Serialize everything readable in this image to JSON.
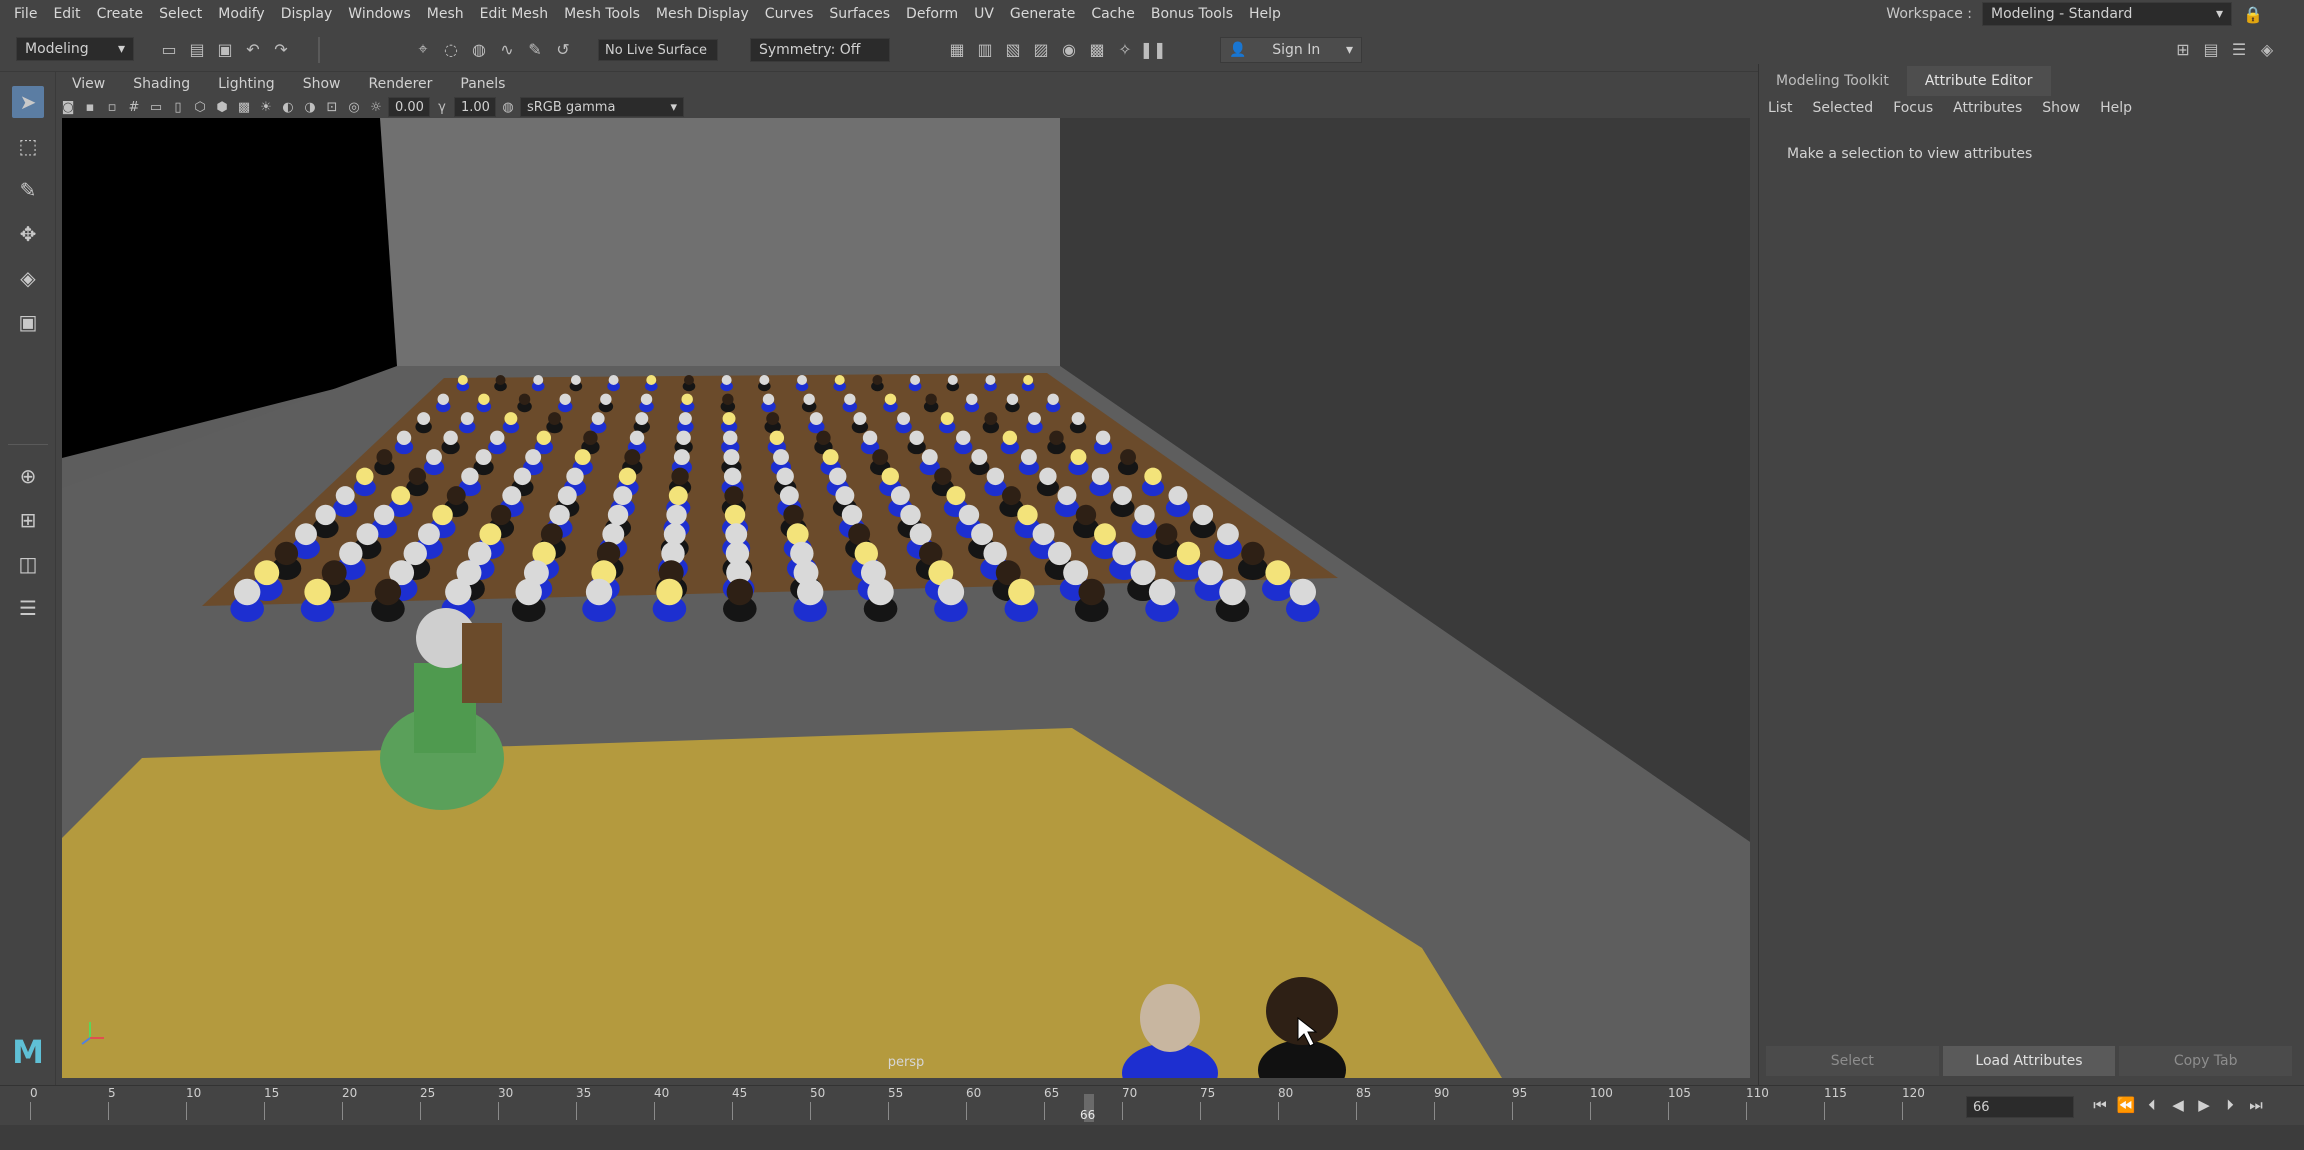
{
  "menubar": {
    "items": [
      "File",
      "Edit",
      "Create",
      "Select",
      "Modify",
      "Display",
      "Windows",
      "Mesh",
      "Edit Mesh",
      "Mesh Tools",
      "Mesh Display",
      "Curves",
      "Surfaces",
      "Deform",
      "UV",
      "Generate",
      "Cache",
      "Bonus Tools",
      "Help"
    ]
  },
  "workspace": {
    "label": "Workspace :",
    "value": "Modeling - Standard"
  },
  "statusline": {
    "mode": "Modeling",
    "live_surface": "No Live Surface",
    "symmetry": "Symmetry: Off",
    "signin": "Sign In"
  },
  "panel": {
    "menu": [
      "View",
      "Shading",
      "Lighting",
      "Show",
      "Renderer",
      "Panels"
    ],
    "exposure": "0.00",
    "gamma": "1.00",
    "color_space": "sRGB gamma",
    "camera": "persp"
  },
  "right_panel": {
    "tabs": [
      "Modeling Toolkit",
      "Attribute Editor"
    ],
    "menu": [
      "List",
      "Selected",
      "Focus",
      "Attributes",
      "Show",
      "Help"
    ],
    "message": "Make a selection to view attributes",
    "buttons": [
      "Select",
      "Load Attributes",
      "Copy Tab"
    ]
  },
  "timeline": {
    "ticks": [
      "0",
      "5",
      "10",
      "15",
      "20",
      "25",
      "30",
      "35",
      "40",
      "45",
      "50",
      "55",
      "60",
      "65",
      "70",
      "75",
      "80",
      "85",
      "90",
      "95",
      "100",
      "105",
      "110",
      "115",
      "120"
    ],
    "current_frame": "66",
    "current_marker": "66"
  },
  "colors": {
    "accent": "#5b7da3",
    "floor_stage": "#b49a3e",
    "blue_uniform": "#1d2fd0",
    "green_dress": "#5aa05a"
  }
}
